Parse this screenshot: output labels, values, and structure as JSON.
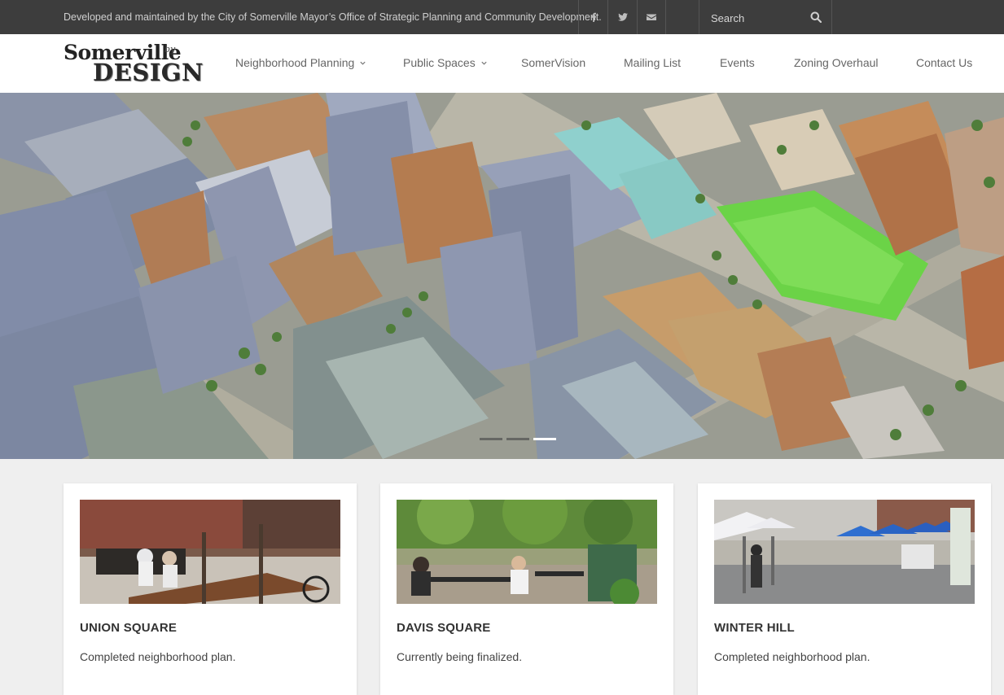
{
  "topbar": {
    "note": "Developed and maintained by the City of Somerville Mayor’s Office of Strategic Planning and Community Development.",
    "social_icons": [
      "facebook-icon",
      "twitter-icon",
      "envelope-icon"
    ],
    "search_placeholder": "Search"
  },
  "logo": {
    "line1": "Somerville",
    "by": "by",
    "line2": "DESIGN"
  },
  "nav": {
    "items": [
      {
        "label": "Neighborhood Planning",
        "dropdown": true
      },
      {
        "label": "Public Spaces",
        "dropdown": true
      },
      {
        "label": "SomerVision",
        "dropdown": false
      },
      {
        "label": "Mailing List",
        "dropdown": false
      },
      {
        "label": "Events",
        "dropdown": false
      },
      {
        "label": "Zoning Overhaul",
        "dropdown": false
      },
      {
        "label": "Contact Us",
        "dropdown": false
      }
    ]
  },
  "hero": {
    "slide_count": 3,
    "active_slide": 3
  },
  "cards": [
    {
      "title": "UNION SQUARE",
      "description": "Completed neighborhood plan."
    },
    {
      "title": "DAVIS SQUARE",
      "description": "Currently being finalized."
    },
    {
      "title": "WINTER HILL",
      "description": "Completed neighborhood plan."
    }
  ],
  "colors": {
    "topbar_bg": "#3d3d3d",
    "page_bg": "#efefef",
    "card_bg": "#ffffff",
    "nav_text": "#666666"
  }
}
